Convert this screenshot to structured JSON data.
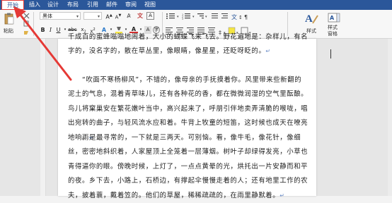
{
  "tabs": [
    {
      "label": "开始"
    },
    {
      "label": "插入"
    },
    {
      "label": "设计"
    },
    {
      "label": "布局"
    },
    {
      "label": "引用"
    },
    {
      "label": "邮件"
    },
    {
      "label": "审阅"
    },
    {
      "label": "视图"
    }
  ],
  "ribbon": {
    "paste_label": "粘贴",
    "font_name": "黑体",
    "font_size": "",
    "styles_label": "样式",
    "styles_pane_label1": "样式",
    "styles_pane_label2": "窗格"
  },
  "document": {
    "paragraphs": [
      "千成百的蜜蜂嗡嗡地闹着，大小的蝴蝶飞来飞去。野花遍地是：杂样儿，有名字的，没名字的，散在草丛里，像眼睛，像星星，还眨呀眨的。",
      "“吹面不寒杨柳风”，不错的，像母亲的手抚摸着你。风里带来些新翻的泥土的气息，混着青草味儿，还有各种花的香，都在微微润湿的空气里酝酿。鸟儿将窠巢安在繁花嫩叶当中，高兴起来了，呼朋引伴地卖弄清脆的喉咙，唱出宛转的曲子，与轻风流水应和着。牛背上牧童的短笛，这时候也成天在嘹亮地响。",
      "雨是最寻常的，一下就是三两天。可别恼。看，像牛毛，像花针，像细丝，密密地斜织着，人家屋顶上全笼着一层薄烟。树叶子却绿得发亮，小草也青得逼你的眼。傍晚时候，上灯了，一点点黄晕的光，烘托出一片安静而和平的夜。乡下去，小路上，石桥边，有撑起伞慢慢走着的人；还有地里工作的农夫，披着蓑，戴着笠的。他们的草屋，稀稀疏疏的，在雨里静默着。"
    ],
    "paragraph_mark": "↵"
  },
  "colors": {
    "ribbon_blue": "#2b579a",
    "highlight_red": "#e53935",
    "font_color_red": "#d32f2f",
    "highlight_yellow": "#f5e642"
  }
}
